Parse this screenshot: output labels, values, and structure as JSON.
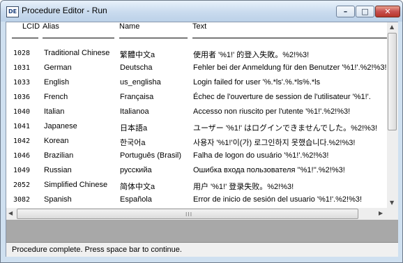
{
  "window": {
    "title": "Procedure Editor - Run",
    "app_icon_text": "DE",
    "buttons": {
      "minimize": "–",
      "maximize": "□",
      "close": "✕"
    }
  },
  "table": {
    "columns": [
      "LCID",
      "Alias",
      "Name",
      "Text"
    ],
    "rows": [
      [
        "1028",
        "Traditional Chinese",
        "繁體中文a",
        "使用者 '%1!' 的登入失敗。%2!%3!"
      ],
      [
        "1031",
        "German",
        "Deutscha",
        "Fehler bei der Anmeldung für den Benutzer '%1!'.%2!%3!"
      ],
      [
        "1033",
        "English",
        "us_englisha",
        "Login failed for user '%.*ls'.%.*ls%.*ls"
      ],
      [
        "1036",
        "French",
        "Françaisa",
        "Échec de l'ouverture de session de l'utilisateur '%1!'."
      ],
      [
        "1040",
        "Italian",
        "Italianoa",
        "Accesso non riuscito per l'utente '%1!'.%2!%3!"
      ],
      [
        "1041",
        "Japanese",
        "日本語a",
        "ユーザー '%1!' はログインできませんでした。%2!%3!"
      ],
      [
        "1042",
        "Korean",
        "한국어a",
        "사용자 '%1!'이(가) 로그인하지 못했습니다.%2!%3!"
      ],
      [
        "1046",
        "Brazilian",
        "Português (Brasil)",
        "Falha de logon do usuário '%1!'.%2!%3!"
      ],
      [
        "1049",
        "Russian",
        "русскийa",
        "Ошибка входа пользователя ''%1!''.%2!%3!"
      ],
      [
        "2052",
        "Simplified Chinese",
        "简体中文a",
        "用户 '%1!' 登录失败。%2!%3!"
      ],
      [
        "3082",
        "Spanish",
        "Españolа",
        "Error de inicio de sesión del usuario '%1!'.%2!%3!"
      ]
    ]
  },
  "scroll": {
    "up": "▲",
    "down": "▼",
    "left": "◀",
    "right": "▶",
    "grip": "III"
  },
  "status": {
    "text": "Procedure complete. Press space bar to continue."
  }
}
